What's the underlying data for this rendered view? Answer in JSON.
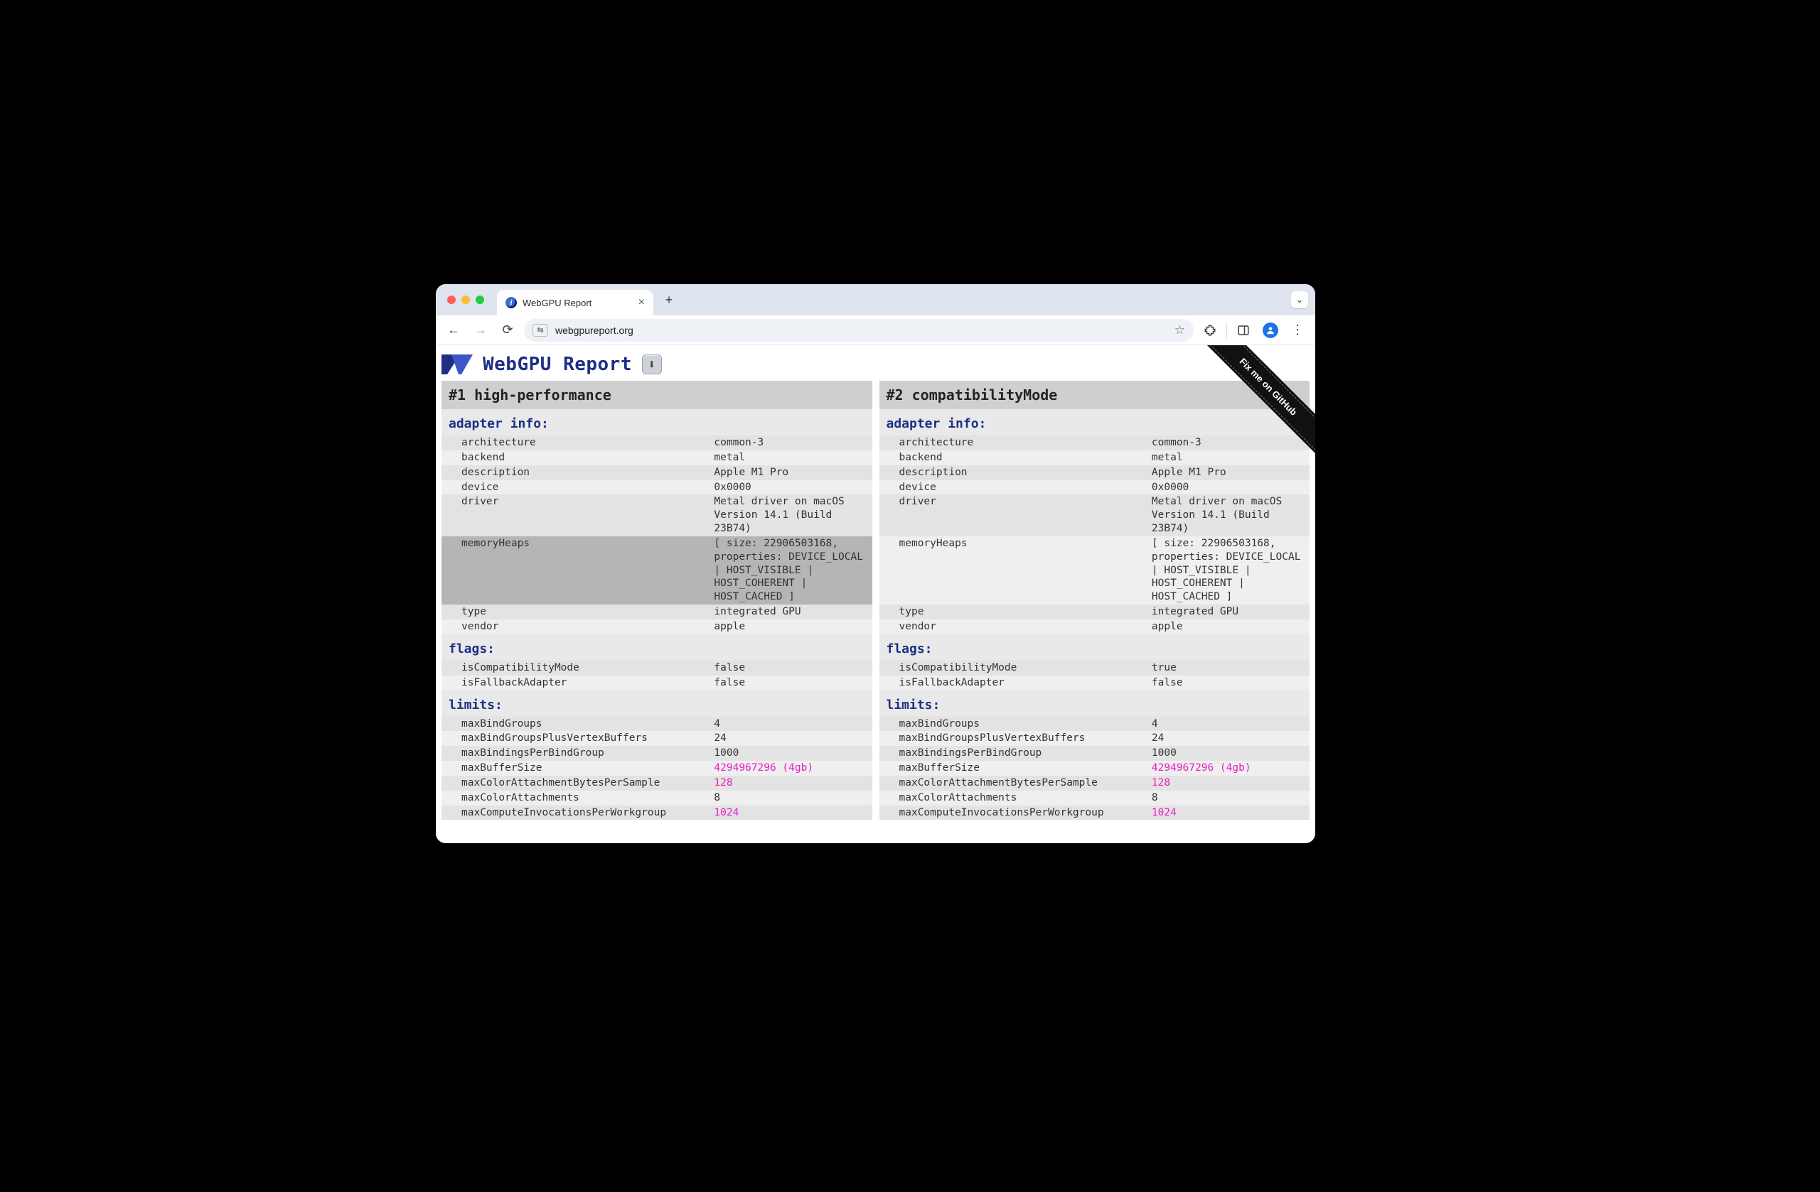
{
  "browser": {
    "tab_title": "WebGPU Report",
    "url": "webgpureport.org",
    "site_chip": "⇆"
  },
  "page_title": "WebGPU Report",
  "download_icon": "⬇",
  "github_ribbon": "Fix me on GitHub",
  "columns": [
    {
      "heading": "#1 high-performance",
      "sections": [
        {
          "title": "adapter info:",
          "rows": [
            {
              "key": "architecture",
              "val": "common-3"
            },
            {
              "key": "backend",
              "val": "metal"
            },
            {
              "key": "description",
              "val": "Apple M1 Pro"
            },
            {
              "key": "device",
              "val": "0x0000"
            },
            {
              "key": "driver",
              "val": "Metal driver on macOS Version 14.1 (Build 23B74)"
            },
            {
              "key": "memoryHeaps",
              "val": "[ size: 22906503168, properties: DEVICE_LOCAL | HOST_VISIBLE | HOST_COHERENT | HOST_CACHED ]",
              "hl": true
            },
            {
              "key": "type",
              "val": "integrated GPU"
            },
            {
              "key": "vendor",
              "val": "apple"
            }
          ]
        },
        {
          "title": "flags:",
          "rows": [
            {
              "key": "isCompatibilityMode",
              "val": "false"
            },
            {
              "key": "isFallbackAdapter",
              "val": "false"
            }
          ]
        },
        {
          "title": "limits:",
          "rows": [
            {
              "key": "maxBindGroups",
              "val": "4"
            },
            {
              "key": "maxBindGroupsPlusVertexBuffers",
              "val": "24"
            },
            {
              "key": "maxBindingsPerBindGroup",
              "val": "1000"
            },
            {
              "key": "maxBufferSize",
              "val": "4294967296 (4gb)",
              "diff": true
            },
            {
              "key": "maxColorAttachmentBytesPerSample",
              "val": "128",
              "diff": true
            },
            {
              "key": "maxColorAttachments",
              "val": "8"
            },
            {
              "key": "maxComputeInvocationsPerWorkgroup",
              "val": "1024",
              "diff": true
            }
          ]
        }
      ]
    },
    {
      "heading": "#2 compatibilityMode",
      "sections": [
        {
          "title": "adapter info:",
          "rows": [
            {
              "key": "architecture",
              "val": "common-3"
            },
            {
              "key": "backend",
              "val": "metal"
            },
            {
              "key": "description",
              "val": "Apple M1 Pro"
            },
            {
              "key": "device",
              "val": "0x0000"
            },
            {
              "key": "driver",
              "val": "Metal driver on macOS Version 14.1 (Build 23B74)"
            },
            {
              "key": "memoryHeaps",
              "val": "[ size: 22906503168, properties: DEVICE_LOCAL | HOST_VISIBLE | HOST_COHERENT | HOST_CACHED ]"
            },
            {
              "key": "type",
              "val": "integrated GPU"
            },
            {
              "key": "vendor",
              "val": "apple"
            }
          ]
        },
        {
          "title": "flags:",
          "rows": [
            {
              "key": "isCompatibilityMode",
              "val": "true"
            },
            {
              "key": "isFallbackAdapter",
              "val": "false"
            }
          ]
        },
        {
          "title": "limits:",
          "rows": [
            {
              "key": "maxBindGroups",
              "val": "4"
            },
            {
              "key": "maxBindGroupsPlusVertexBuffers",
              "val": "24"
            },
            {
              "key": "maxBindingsPerBindGroup",
              "val": "1000"
            },
            {
              "key": "maxBufferSize",
              "val": "4294967296 (4gb)",
              "diff": true
            },
            {
              "key": "maxColorAttachmentBytesPerSample",
              "val": "128",
              "diff": true
            },
            {
              "key": "maxColorAttachments",
              "val": "8"
            },
            {
              "key": "maxComputeInvocationsPerWorkgroup",
              "val": "1024",
              "diff": true
            }
          ]
        }
      ]
    }
  ]
}
